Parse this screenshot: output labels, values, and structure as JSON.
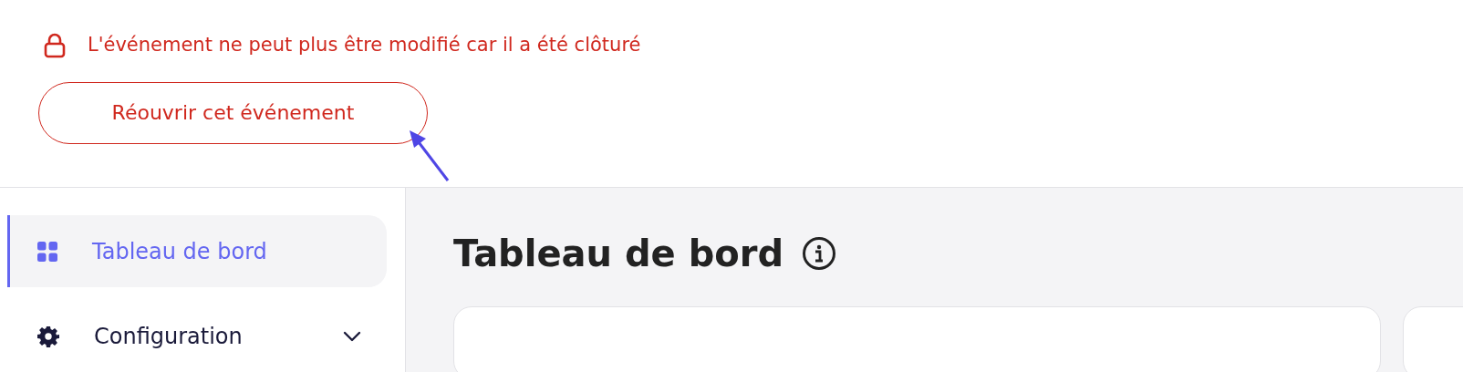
{
  "notice": {
    "message": "L'événement ne peut plus être modifié car il a été clôturé",
    "button": "Réouvrir cet événement"
  },
  "sidebar": {
    "items": [
      {
        "kind": "link",
        "label": "Tableau de bord",
        "selected": true
      },
      {
        "kind": "group",
        "label": "Configuration",
        "selected": false,
        "expanded": false
      }
    ]
  },
  "main": {
    "title": "Tableau de bord"
  }
}
